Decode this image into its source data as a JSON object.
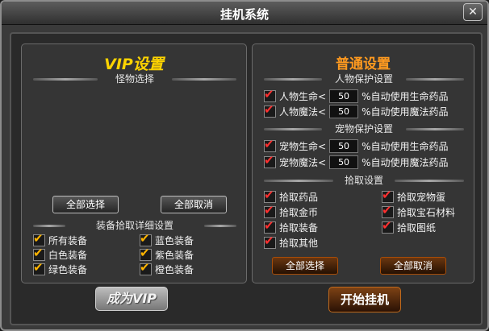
{
  "window": {
    "title": "挂机系统"
  },
  "vip": {
    "title": "VIP设置",
    "monster_section": "怪物选择",
    "select_all": "全部选择",
    "cancel_all": "全部取消",
    "equip_section": "装备拾取详细设置",
    "equip_items": [
      {
        "label": "所有装备",
        "checked": true
      },
      {
        "label": "蓝色装备",
        "checked": true
      },
      {
        "label": "白色装备",
        "checked": true
      },
      {
        "label": "紫色装备",
        "checked": true
      },
      {
        "label": "绿色装备",
        "checked": true
      },
      {
        "label": "橙色装备",
        "checked": true
      }
    ],
    "become_vip": "成为VIP"
  },
  "normal": {
    "title": "普通设置",
    "char_section": "人物保护设置",
    "char_rows": [
      {
        "label": "人物生命<",
        "value": "50",
        "suffix": "%自动使用生命药品",
        "checked": true
      },
      {
        "label": "人物魔法<",
        "value": "50",
        "suffix": "%自动使用魔法药品",
        "checked": true
      }
    ],
    "pet_section": "宠物保护设置",
    "pet_rows": [
      {
        "label": "宠物生命<",
        "value": "50",
        "suffix": "%自动使用生命药品",
        "checked": true
      },
      {
        "label": "宠物魔法<",
        "value": "50",
        "suffix": "%自动使用魔法药品",
        "checked": true
      }
    ],
    "pickup_section": "拾取设置",
    "pickup_items": [
      {
        "label": "拾取药品",
        "checked": true
      },
      {
        "label": "拾取宠物蛋",
        "checked": true
      },
      {
        "label": "拾取金币",
        "checked": true
      },
      {
        "label": "拾取宝石材料",
        "checked": true
      },
      {
        "label": "拾取装备",
        "checked": true
      },
      {
        "label": "拾取图纸",
        "checked": true
      },
      {
        "label": "拾取其他",
        "checked": true
      }
    ],
    "select_all": "全部选择",
    "cancel_all": "全部取消",
    "start": "开始挂机"
  },
  "icons": {
    "close": "close-icon",
    "check": "checkmark-icon"
  },
  "colors": {
    "vip_title": "#ffd400",
    "normal_title": "#ff9a1f",
    "check_red": "#ff3030",
    "check_gold": "#ffb400"
  }
}
